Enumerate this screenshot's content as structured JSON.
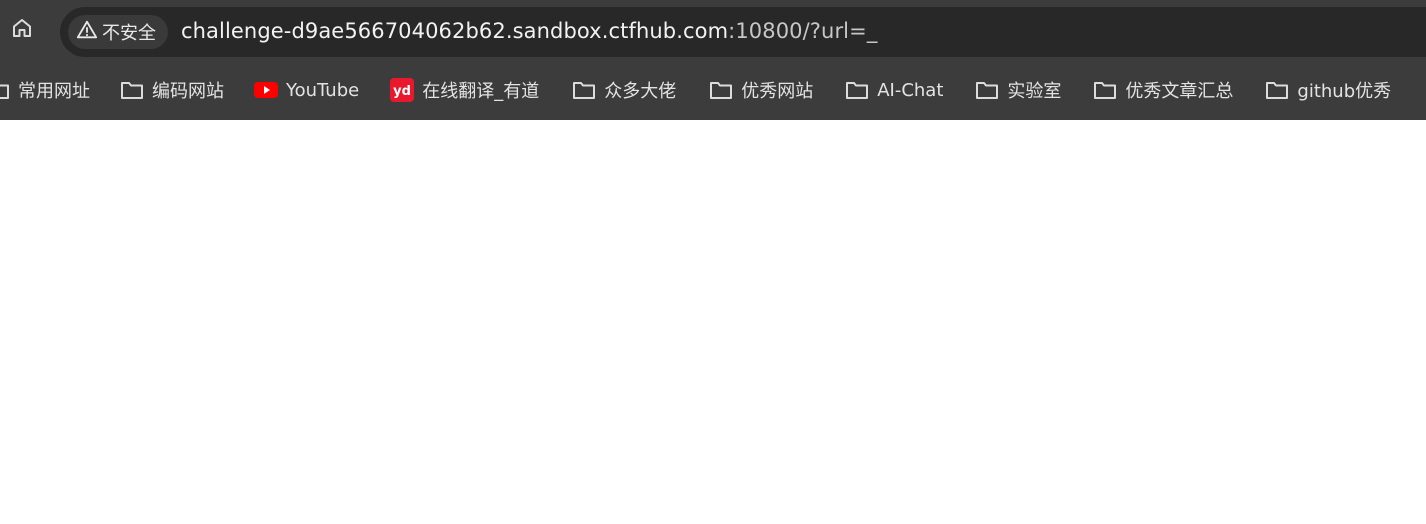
{
  "toolbar": {
    "home_icon": "home-icon",
    "security_label": "不安全",
    "security_icon": "warning-triangle-icon",
    "url_host": "challenge-d9ae566704062b62.sandbox.ctfhub.com",
    "url_rest": ":10800/?url=_"
  },
  "bookmarks": [
    {
      "label": "常用网址",
      "icon": "folder-icon"
    },
    {
      "label": "编码网站",
      "icon": "folder-icon"
    },
    {
      "label": "YouTube",
      "icon": "youtube-icon"
    },
    {
      "label": "在线翻译_有道",
      "icon": "youdao-icon"
    },
    {
      "label": "众多大佬",
      "icon": "folder-icon"
    },
    {
      "label": "优秀网站",
      "icon": "folder-icon"
    },
    {
      "label": "AI-Chat",
      "icon": "folder-icon"
    },
    {
      "label": "实验室",
      "icon": "folder-icon"
    },
    {
      "label": "优秀文章汇总",
      "icon": "folder-icon"
    },
    {
      "label": "github优秀",
      "icon": "folder-icon"
    }
  ],
  "colors": {
    "chrome_bg": "#3c3c3c",
    "omnibox_bg": "#282828",
    "youtube_red": "#ff0000",
    "youdao_red": "#e8192c",
    "page_bg": "#ffffff"
  }
}
